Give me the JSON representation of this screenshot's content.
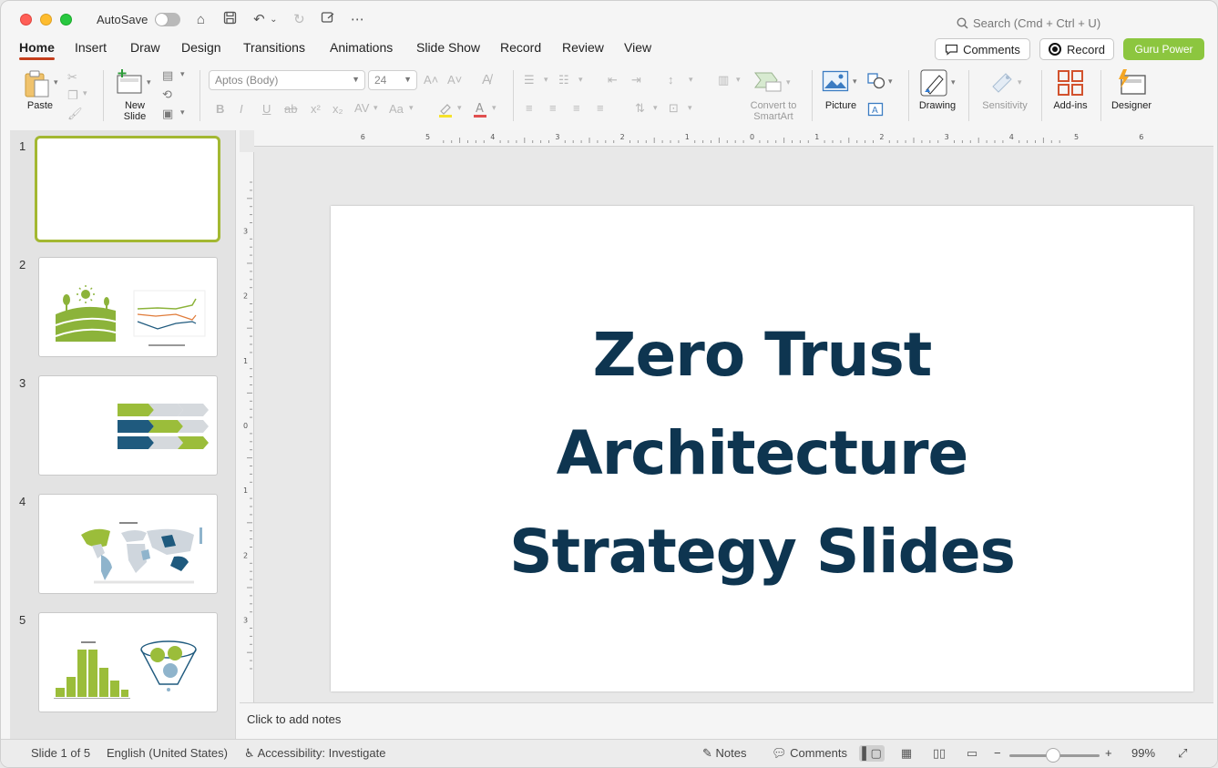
{
  "titlebar": {
    "autosave_label": "AutoSave",
    "search_placeholder": "Search (Cmd + Ctrl + U)"
  },
  "tabs": [
    {
      "label": "Home",
      "active": true
    },
    {
      "label": "Insert"
    },
    {
      "label": "Draw"
    },
    {
      "label": "Design"
    },
    {
      "label": "Transitions"
    },
    {
      "label": "Animations"
    },
    {
      "label": "Slide Show"
    },
    {
      "label": "Record"
    },
    {
      "label": "Review"
    },
    {
      "label": "View"
    }
  ],
  "header_buttons": {
    "comments": "Comments",
    "record": "Record",
    "guru": "Guru Power"
  },
  "ribbon": {
    "paste": "Paste",
    "new_slide": "New\nSlide",
    "font_name": "Aptos (Body)",
    "font_size": "24",
    "convert_smartart": "Convert to\nSmartArt",
    "picture": "Picture",
    "drawing": "Drawing",
    "sensitivity": "Sensitivity",
    "addins": "Add-ins",
    "designer": "Designer"
  },
  "thumbnails": [
    {
      "num": "1"
    },
    {
      "num": "2"
    },
    {
      "num": "3"
    },
    {
      "num": "4"
    },
    {
      "num": "5"
    }
  ],
  "slide": {
    "title_line1": "Zero Trust",
    "title_line2": "Architecture",
    "title_line3": "Strategy Slides"
  },
  "notes_placeholder": "Click to add notes",
  "status": {
    "slide_count": "Slide 1 of 5",
    "language": "English (United States)",
    "accessibility": "Accessibility: Investigate",
    "notes": "Notes",
    "comments": "Comments",
    "zoom": "99%"
  },
  "colors": {
    "accent_green": "#8cc63f",
    "title_navy": "#0e3550",
    "tab_underline": "#c43e1c"
  }
}
